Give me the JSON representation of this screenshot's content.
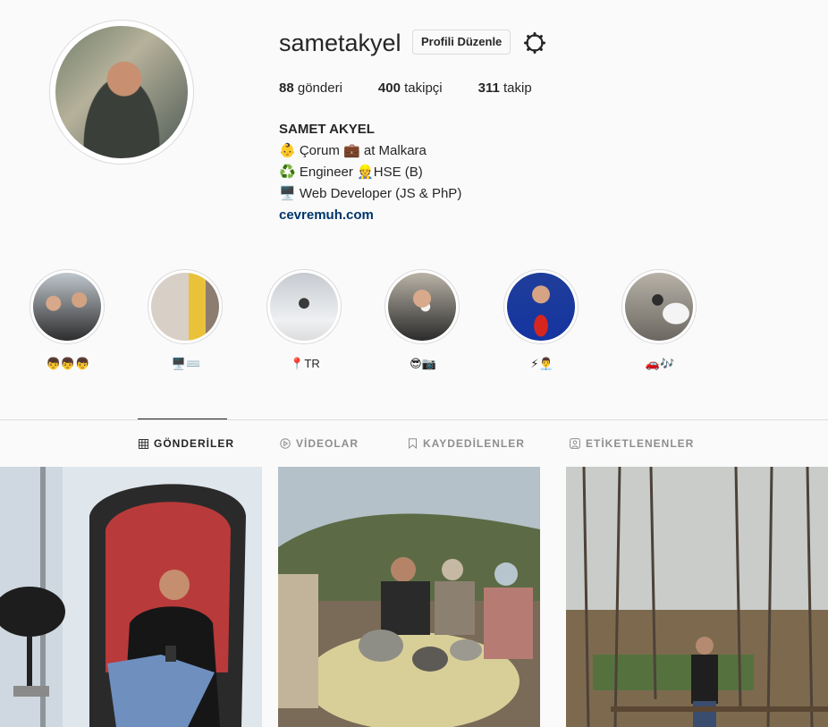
{
  "profile": {
    "username": "sametakyel",
    "edit_label": "Profili Düzenle",
    "posts_count": "88",
    "posts_label": "gönderi",
    "followers_count": "400",
    "followers_label": "takipçi",
    "following_count": "311",
    "following_label": "takip",
    "full_name": "SAMET AKYEL",
    "bio_lines": [
      "👶 Çorum 💼 at Malkara",
      "♻️ Engineer 👷HSE (B)",
      "🖥️ Web Developer (JS & PhP)"
    ],
    "website": "cevremuh.com"
  },
  "highlights": [
    {
      "label": "👦👦👦"
    },
    {
      "label": "🖥️⌨️"
    },
    {
      "label": "📍TR"
    },
    {
      "label": "😎📷"
    },
    {
      "label": "⚡👨‍💼"
    },
    {
      "label": "🚗🎶"
    }
  ],
  "tabs": [
    {
      "label": "GÖNDERİLER",
      "icon": "grid-icon"
    },
    {
      "label": "VİDEOLAR",
      "icon": "play-icon"
    },
    {
      "label": "KAYDEDİLENLER",
      "icon": "bookmark-icon"
    },
    {
      "label": "ETİKETLENENLER",
      "icon": "tag-icon"
    }
  ],
  "colors": {
    "link": "#003569",
    "border": "#dbdbdb",
    "background": "#fafafa",
    "muted": "#8e8e8e"
  }
}
